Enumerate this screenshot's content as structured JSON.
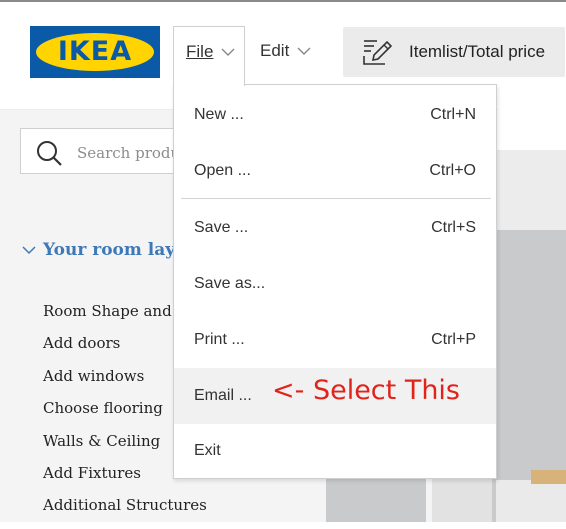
{
  "header": {
    "logo_text": "IKEA",
    "logo_mark": "®",
    "menus": [
      {
        "label": "File",
        "icon": "chevron-down-icon"
      },
      {
        "label": "Edit",
        "icon": "chevron-down-icon"
      }
    ],
    "itemlist_button": {
      "label": "Itemlist/Total price",
      "icon": "list-edit-icon"
    }
  },
  "sidebar": {
    "search": {
      "placeholder": "Search products",
      "icon": "search-icon"
    },
    "section": {
      "label": "Your room layout",
      "icon": "chevron-down-icon",
      "color": "#3e78b7"
    },
    "items": [
      "Room Shape and Size",
      "Add doors",
      "Add windows",
      "Choose flooring",
      "Walls & Ceiling",
      "Add Fixtures",
      "Additional Structures"
    ]
  },
  "file_menu": {
    "items": [
      {
        "label": "New ...",
        "shortcut": "Ctrl+N"
      },
      {
        "label": "Open ...",
        "shortcut": "Ctrl+O"
      },
      {
        "label": "Save ...",
        "shortcut": "Ctrl+S"
      },
      {
        "label": "Save as...",
        "shortcut": ""
      },
      {
        "label": "Print ...",
        "shortcut": "Ctrl+P"
      },
      {
        "label": "Email ...",
        "shortcut": ""
      },
      {
        "label": "Exit",
        "shortcut": ""
      }
    ],
    "highlighted": "Email ..."
  },
  "annotation": {
    "text": "<- Select This",
    "color": "#e0231b"
  },
  "colors": {
    "brand_blue": "#0a5aa8",
    "brand_yellow": "#ffd400"
  }
}
